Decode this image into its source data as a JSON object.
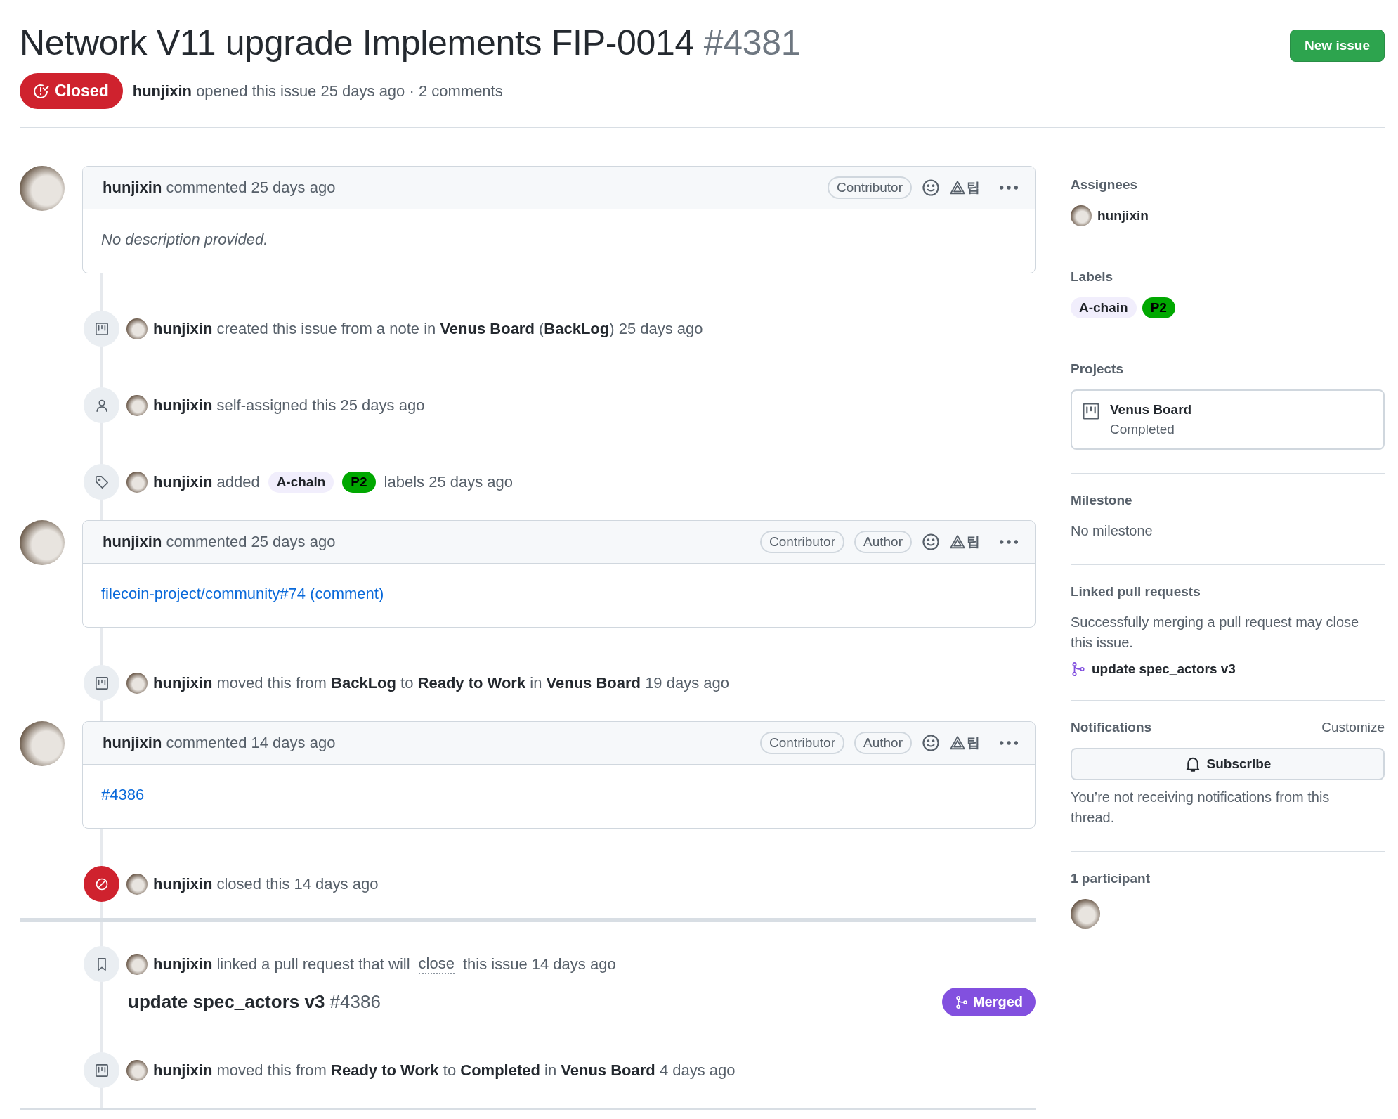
{
  "header": {
    "title": "Network V11 upgrade Implements FIP-0014",
    "number": "#4381",
    "new_issue_button": "New issue",
    "state": {
      "kind": "closed",
      "label": "Closed"
    },
    "meta": "**hunjixin** opened this issue 25 days ago · 2 comments"
  },
  "timeline": [
    {
      "kind": "comment",
      "author": "hunjixin",
      "action": "commented 25 days ago",
      "badges": [
        "Contributor"
      ],
      "extension_label": "팁",
      "body": {
        "kind": "italic",
        "text": "No description provided."
      }
    },
    {
      "kind": "project_event",
      "parts": [
        {
          "kind": "text",
          "text": "**hunjixin** created this issue from a note in **Venus Board** (**BackLog**) 25 days ago"
        }
      ]
    },
    {
      "kind": "assign_event",
      "parts": [
        {
          "kind": "text",
          "text": "**hunjixin** self-assigned this 25 days ago"
        }
      ]
    },
    {
      "kind": "label_event",
      "parts": [
        {
          "kind": "text",
          "text": "**hunjixin** added"
        },
        {
          "kind": "label",
          "text": "A-chain",
          "color": "#f1eefc"
        },
        {
          "kind": "label",
          "text": "P2",
          "color": "#00a800"
        },
        {
          "kind": "text",
          "text": "labels 25 days ago"
        }
      ]
    },
    {
      "kind": "comment",
      "author": "hunjixin",
      "action": "commented 25 days ago",
      "badges": [
        "Contributor",
        "Author"
      ],
      "extension_label": "팁",
      "body": {
        "kind": "link",
        "text": "filecoin-project/community#74 (comment)"
      }
    },
    {
      "kind": "project_event",
      "parts": [
        {
          "kind": "text",
          "text": "**hunjixin** moved this from **BackLog** to **Ready to Work** in **Venus Board** 19 days ago"
        }
      ]
    },
    {
      "kind": "comment",
      "author": "hunjixin",
      "action": "commented 14 days ago",
      "badges": [
        "Contributor",
        "Author"
      ],
      "extension_label": "팁",
      "body": {
        "kind": "link",
        "text": "#4386"
      }
    },
    {
      "kind": "close_event",
      "parts": [
        {
          "kind": "text",
          "text": "**hunjixin** closed this 14 days ago"
        }
      ]
    },
    {
      "kind": "break"
    },
    {
      "kind": "link_event",
      "parts": [
        {
          "kind": "text",
          "text": "**hunjixin** linked a pull request that will"
        },
        {
          "kind": "hint",
          "text": "close"
        },
        {
          "kind": "text",
          "text": "this issue 14 days ago"
        }
      ],
      "pull_request": {
        "title": "update spec_actors v3",
        "number": "#4386",
        "state": "Merged"
      }
    },
    {
      "kind": "project_event",
      "parts": [
        {
          "kind": "text",
          "text": "**hunjixin** moved this from **Ready to Work** to **Completed** in **Venus Board** 4 days ago"
        }
      ]
    }
  ],
  "sidebar": {
    "assignees": {
      "heading": "Assignees",
      "people": [
        "hunjixin"
      ]
    },
    "labels": {
      "heading": "Labels",
      "items": [
        {
          "text": "A-chain",
          "color": "#f1eefc"
        },
        {
          "text": "P2",
          "color": "#00a800"
        }
      ]
    },
    "projects": {
      "heading": "Projects",
      "items": [
        {
          "name": "Venus Board",
          "column": "Completed"
        }
      ]
    },
    "milestone": {
      "heading": "Milestone",
      "value": "No milestone"
    },
    "linked_pull_requests": {
      "heading": "Linked pull requests",
      "note": "Successfully merging a pull request may close this issue.",
      "items": [
        "update spec_actors v3"
      ]
    },
    "notifications": {
      "heading": "Notifications",
      "customize": "Customize",
      "button": "Subscribe",
      "note": "You’re not receiving notifications from this thread."
    },
    "participants": {
      "heading": "1 participant"
    }
  }
}
